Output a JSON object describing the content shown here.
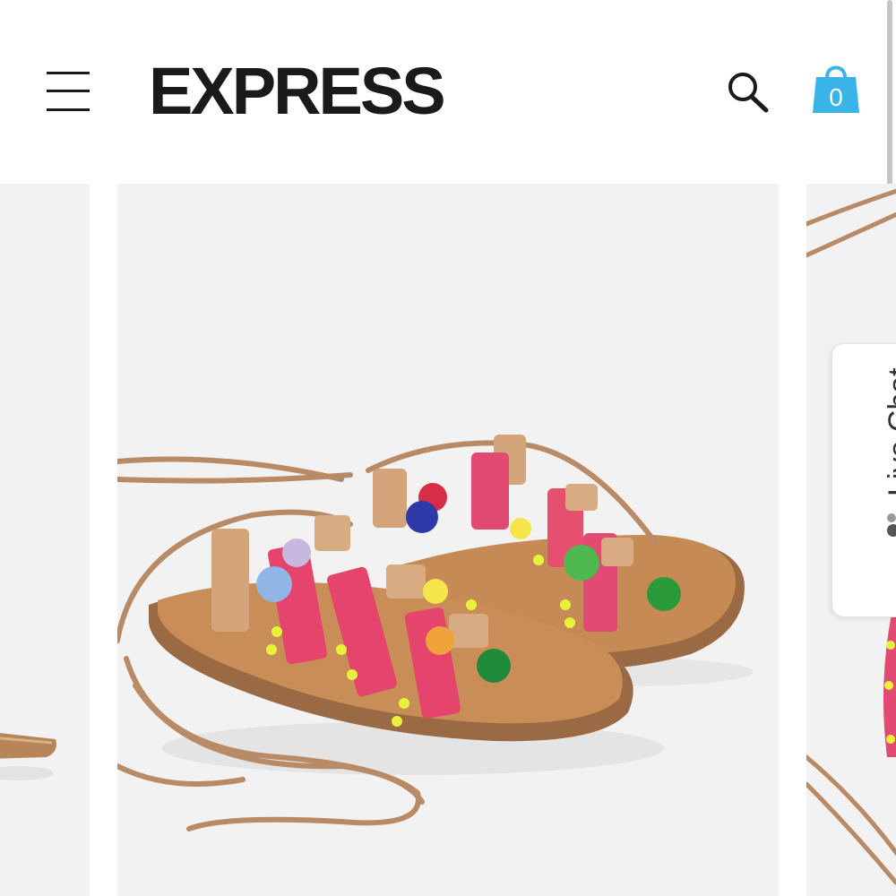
{
  "header": {
    "logo_text": "EXPRESS",
    "cart_count": "0",
    "icons": {
      "menu": "hamburger-menu-icon",
      "search": "search-icon",
      "cart": "shopping-bag-icon"
    },
    "colors": {
      "logo": "#1a1a1a",
      "cart": "#3ab3e6"
    }
  },
  "carousel": {
    "current_product_image": "lace-up-pom-pom-gladiator-sandals",
    "background": "#f2f2f2"
  },
  "live_chat": {
    "label": "Live Chat",
    "icon": "chat-people-icon"
  }
}
